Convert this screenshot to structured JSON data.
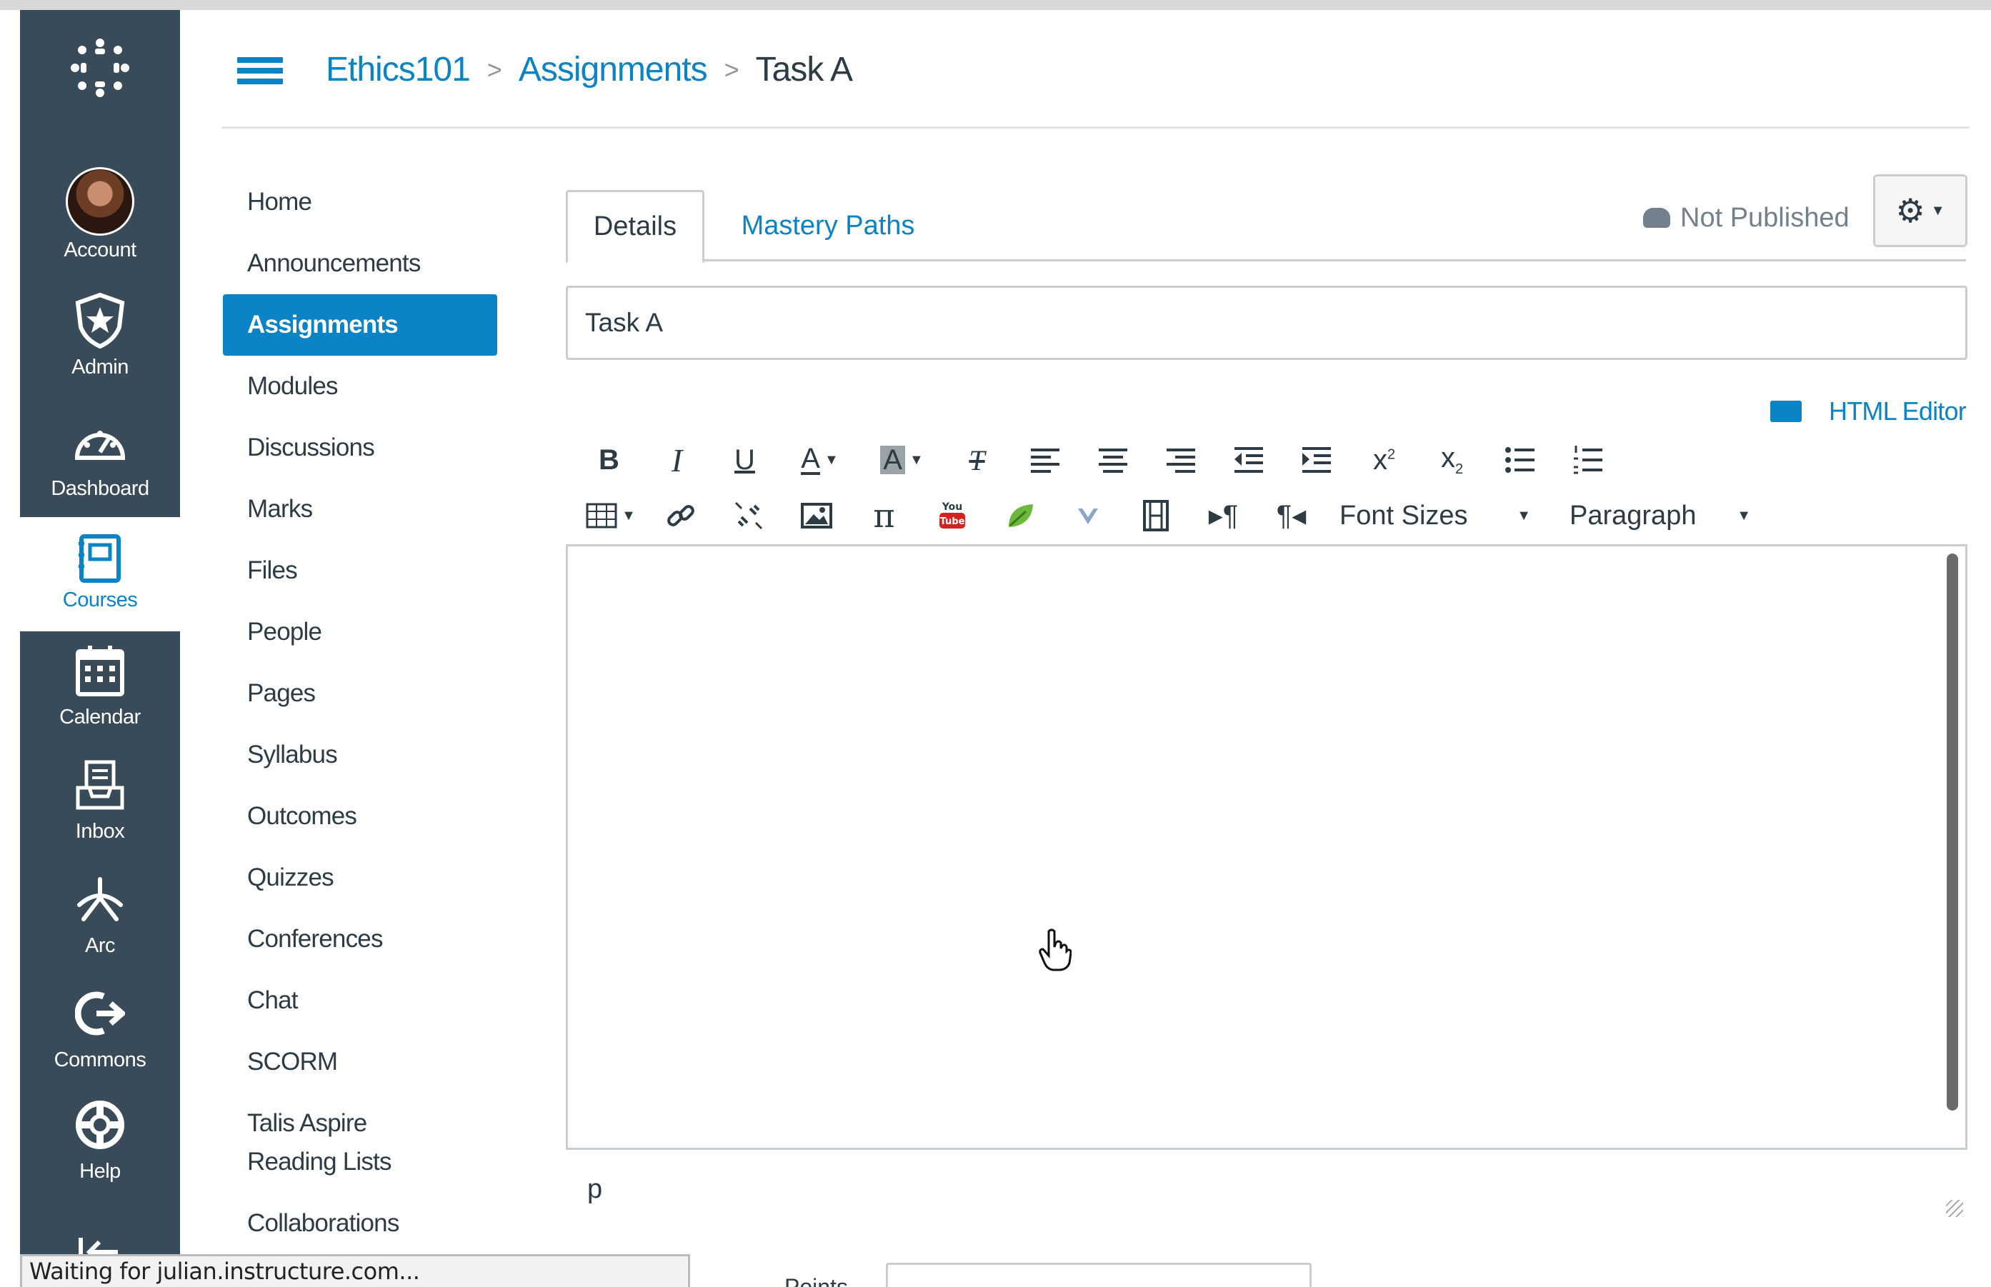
{
  "global_nav": {
    "account": "Account",
    "admin": "Admin",
    "dashboard": "Dashboard",
    "courses": "Courses",
    "calendar": "Calendar",
    "inbox": "Inbox",
    "arc": "Arc",
    "commons": "Commons",
    "help": "Help"
  },
  "breadcrumb": {
    "course": "Ethics101",
    "section": "Assignments",
    "current": "Task A",
    "separator": ">"
  },
  "course_nav": {
    "items": [
      {
        "label": "Home"
      },
      {
        "label": "Announcements"
      },
      {
        "label": "Assignments"
      },
      {
        "label": "Modules"
      },
      {
        "label": "Discussions"
      },
      {
        "label": "Marks"
      },
      {
        "label": "Files"
      },
      {
        "label": "People"
      },
      {
        "label": "Pages"
      },
      {
        "label": "Syllabus"
      },
      {
        "label": "Outcomes"
      },
      {
        "label": "Quizzes"
      },
      {
        "label": "Conferences"
      },
      {
        "label": "Chat"
      },
      {
        "label": "SCORM"
      },
      {
        "label": "Talis Aspire Reading Lists"
      },
      {
        "label": "Collaborations"
      }
    ],
    "active_index": 2
  },
  "tabs": {
    "details": "Details",
    "mastery_paths": "Mastery Paths"
  },
  "publish_status": "Not Published",
  "title_input": {
    "value": "Task A"
  },
  "html_editor_link": "HTML Editor",
  "toolbar": {
    "font_sizes": "Font Sizes",
    "paragraph": "Paragraph"
  },
  "editor": {
    "status_path": "p"
  },
  "browser_status": "Waiting for julian.instructure.com...",
  "points_label": "Points",
  "colors": {
    "nav_bg": "#394b58",
    "accent": "#0a84c6",
    "text": "#2d3b45"
  }
}
